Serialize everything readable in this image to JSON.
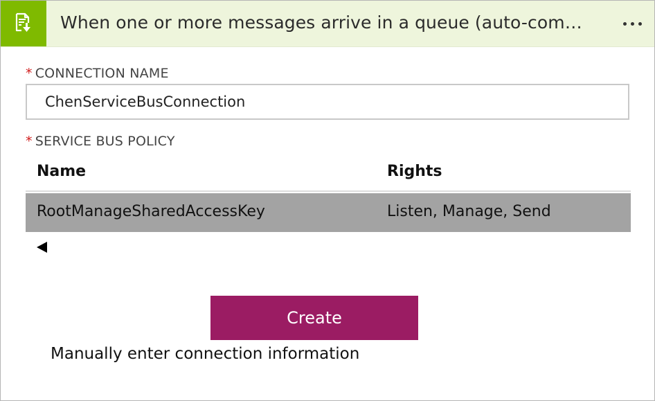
{
  "header": {
    "icon": "service-bus-queue-icon",
    "title": "When one or more messages arrive in a queue (auto-com…",
    "more_icon": "more-options-icon",
    "brand_color": "#7fba00"
  },
  "connection_name": {
    "required_marker": "*",
    "label": "CONNECTION NAME",
    "value": "ChenServiceBusConnection"
  },
  "service_bus_policy": {
    "required_marker": "*",
    "label": "SERVICE BUS POLICY",
    "columns": {
      "name": "Name",
      "rights": "Rights"
    },
    "rows": [
      {
        "name": "RootManageSharedAccessKey",
        "rights": "Listen, Manage, Send",
        "selected": true
      }
    ],
    "scroll_icon": "scroll-left-arrow-icon"
  },
  "actions": {
    "create_label": "Create",
    "create_color": "#9b1c63",
    "manual_link_label": "Manually enter connection information"
  }
}
